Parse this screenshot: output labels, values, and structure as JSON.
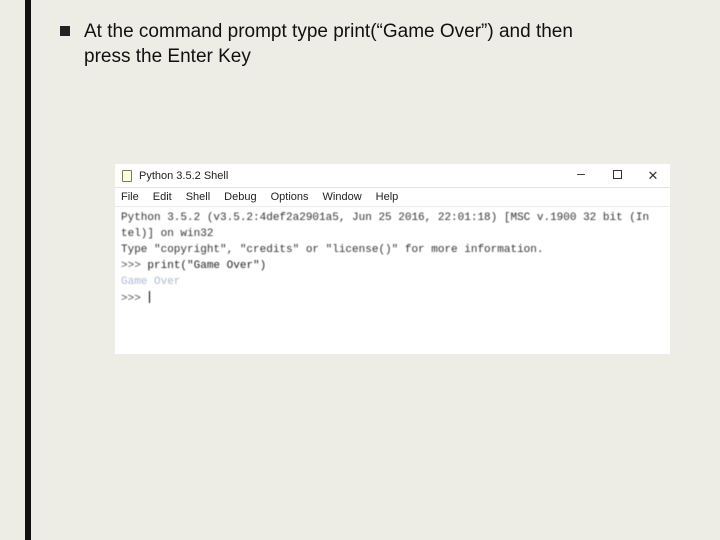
{
  "slide": {
    "bullet_text": "At the command prompt type print(“Game Over”) and then press the Enter Key"
  },
  "shell": {
    "title": "Python 3.5.2 Shell",
    "menu": [
      "File",
      "Edit",
      "Shell",
      "Debug",
      "Options",
      "Window",
      "Help"
    ],
    "banner_line1": "Python 3.5.2 (v3.5.2:4def2a2901a5, Jun 25 2016, 22:01:18) [MSC v.1900 32 bit (In",
    "banner_line2": "tel)] on win32",
    "banner_line3": "Type \"copyright\", \"credits\" or \"license()\" for more information.",
    "prompt": ">>>",
    "typed_command": "print(\"Game Over\")",
    "output": "Game Over"
  }
}
